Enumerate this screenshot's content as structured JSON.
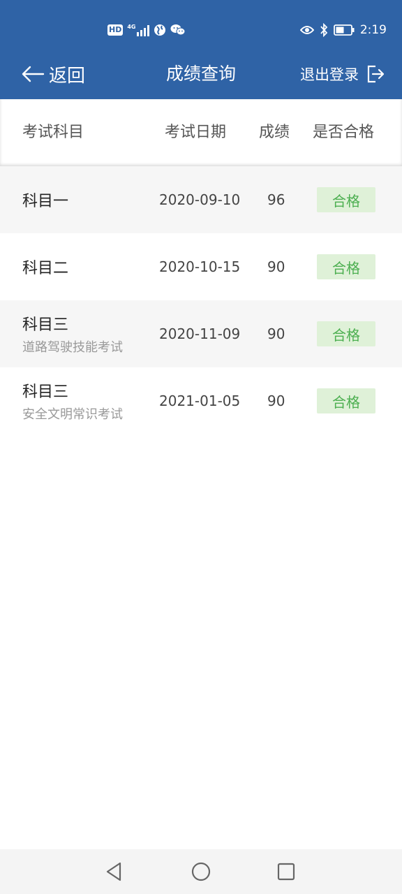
{
  "status_bar": {
    "left_badge": "HD",
    "network": "4G",
    "time": "2:19"
  },
  "header": {
    "back_label": "返回",
    "title": "成绩查询",
    "logout_label": "退出登录"
  },
  "table": {
    "columns": [
      "考试科目",
      "考试日期",
      "成绩",
      "是否合格"
    ],
    "rows": [
      {
        "subject": "科目一",
        "detail": "",
        "date": "2020-09-10",
        "score": "96",
        "result": "合格"
      },
      {
        "subject": "科目二",
        "detail": "",
        "date": "2020-10-15",
        "score": "90",
        "result": "合格"
      },
      {
        "subject": "科目三",
        "detail": "道路驾驶技能考试",
        "date": "2020-11-09",
        "score": "90",
        "result": "合格"
      },
      {
        "subject": "科目三",
        "detail": "安全文明常识考试",
        "date": "2021-01-05",
        "score": "90",
        "result": "合格"
      }
    ]
  },
  "colors": {
    "header_bg": "#2f63a6",
    "pass_bg": "#dff1d8",
    "pass_text": "#4caf50",
    "alt_row_bg": "#f6f6f6"
  },
  "icons": {
    "back": "arrow-left-icon",
    "logout": "logout-icon",
    "nav_back": "triangle-back-icon",
    "nav_home": "circle-home-icon",
    "nav_recent": "square-recent-icon"
  }
}
